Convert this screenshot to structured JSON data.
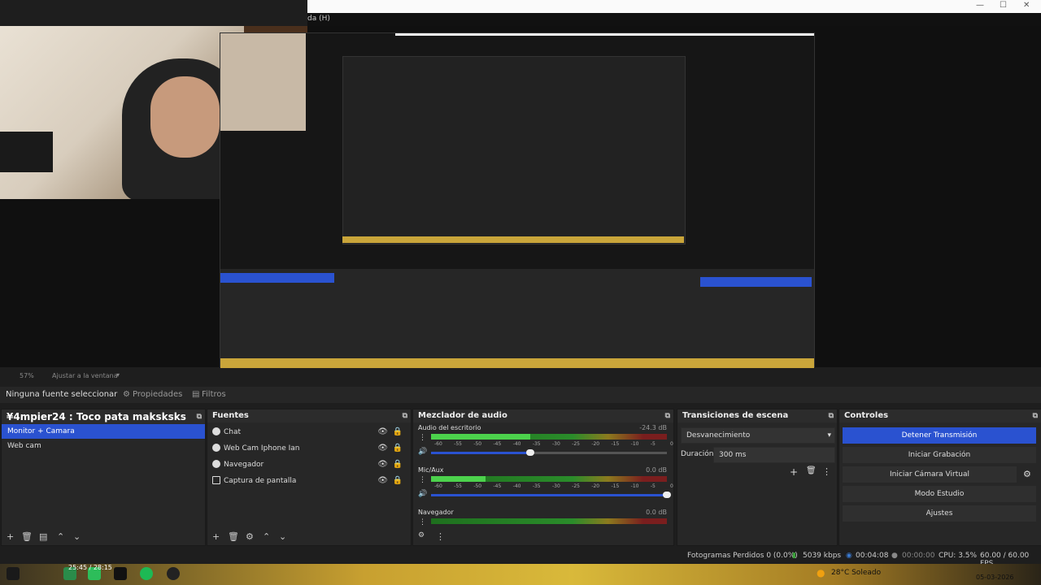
{
  "window": {
    "menu_fragment": "da (H)"
  },
  "preview": {
    "zoom_label": "57%",
    "fit_label": "Ajustar a la ventana"
  },
  "toolbar": {
    "no_source": "Ninguna fuente seleccionar",
    "properties": "Propiedades",
    "filters": "Filtros"
  },
  "scenes": {
    "title": "¥4mpier24 : Toco pata maksksks",
    "items": [
      {
        "label": "Monitor + Camara",
        "selected": true
      },
      {
        "label": "Web cam",
        "selected": false
      }
    ]
  },
  "sources": {
    "title": "Fuentes",
    "items": [
      {
        "label": "Chat",
        "icon": "globe-icon"
      },
      {
        "label": "Web Cam Iphone Ian",
        "icon": "camera-icon"
      },
      {
        "label": "Navegador",
        "icon": "globe-icon"
      },
      {
        "label": "Captura de pantalla",
        "icon": "monitor-icon"
      }
    ]
  },
  "mixer": {
    "title": "Mezclador de audio",
    "ticks": [
      "-60",
      "-55",
      "-50",
      "-45",
      "-40",
      "-35",
      "-30",
      "-25",
      "-20",
      "-15",
      "-10",
      "-5",
      "0"
    ],
    "channels": [
      {
        "name": "Audio del escritorio",
        "db": "-24.3 dB",
        "level": 0.42,
        "volume": 0.42
      },
      {
        "name": "Mic/Aux",
        "db": "0.0 dB",
        "level": 0.23,
        "volume": 1.0
      },
      {
        "name": "Navegador",
        "db": "0.0 dB",
        "level": 0.0,
        "volume": 1.0
      }
    ]
  },
  "transitions": {
    "title": "Transiciones de escena",
    "selected": "Desvanecimiento",
    "duration_label": "Duración",
    "duration_value": "300 ms"
  },
  "controls": {
    "title": "Controles",
    "stop_stream": "Detener Transmisión",
    "start_record": "Iniciar Grabación",
    "virtual_cam": "Iniciar Cámara Virtual",
    "studio_mode": "Modo Estudio",
    "settings": "Ajustes"
  },
  "status": {
    "dropped_frames": "Fotogramas Perdidos 0 (0.0%)",
    "bitrate": "5039 kbps",
    "stream_time": "00:04:08",
    "record_time": "00:00:00",
    "cpu": "CPU: 3.5%",
    "fps": "60.00 / 60.00 FPS"
  },
  "taskbar": {
    "weather": "28°C Soleado",
    "date": "05-03-2026",
    "time_overlay": "25:45 / 28:15"
  },
  "colors": {
    "accent": "#2a52d0",
    "panel": "#272727",
    "live": "#3aa03a"
  }
}
